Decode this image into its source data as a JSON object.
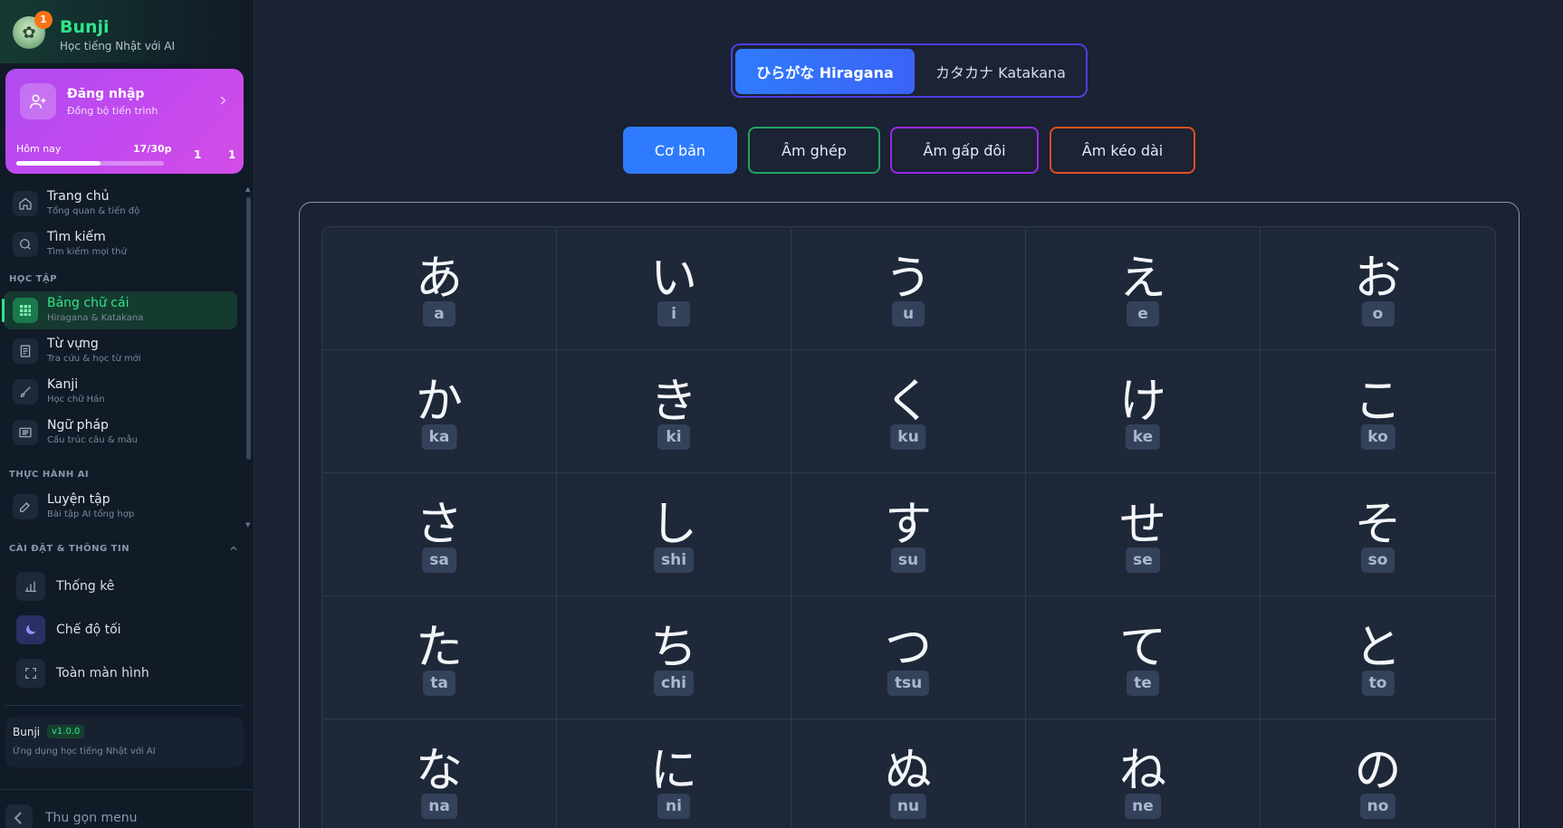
{
  "brand": {
    "name": "Bunji",
    "subtitle": "Học tiếng Nhật với AI",
    "notification_count": "1"
  },
  "login": {
    "title": "Đăng nhập",
    "subtitle": "Đồng bộ tiến trình",
    "today_label": "Hôm nay",
    "today_value": "17/30p",
    "progress_fraction": 0.57,
    "stat_a": "1",
    "stat_b": "1"
  },
  "nav": {
    "items_top": [
      {
        "label": "Trang chủ",
        "sub": "Tổng quan & tiến độ",
        "icon": "home-icon"
      },
      {
        "label": "Tìm kiếm",
        "sub": "Tìm kiếm mọi thứ",
        "icon": "search-icon"
      }
    ],
    "section_learn": "HỌC TẬP",
    "items_learn": [
      {
        "label": "Bảng chữ cái",
        "sub": "Hiragana & Katakana",
        "icon": "grid-icon",
        "active": true
      },
      {
        "label": "Từ vựng",
        "sub": "Tra cứu & học từ mới",
        "icon": "book-icon"
      },
      {
        "label": "Kanji",
        "sub": "Học chữ Hán",
        "icon": "brush-icon"
      },
      {
        "label": "Ngữ pháp",
        "sub": "Cấu trúc câu & mẫu",
        "icon": "list-icon"
      }
    ],
    "section_ai": "THỰC HÀNH AI",
    "items_ai": [
      {
        "label": "Luyện tập",
        "sub": "Bài tập AI tổng hợp",
        "icon": "edit-icon"
      }
    ]
  },
  "settings": {
    "header": "CÀI ĐẶT & THÔNG TIN",
    "items": [
      {
        "label": "Thống kê",
        "icon": "chart-icon"
      },
      {
        "label": "Chế độ tối",
        "icon": "moon-icon"
      },
      {
        "label": "Toàn màn hình",
        "icon": "fullscreen-icon"
      }
    ]
  },
  "app_info": {
    "name": "Bunji",
    "version": "v1.0.0",
    "description": "Ứng dụng học tiếng Nhật với AI"
  },
  "collapse_label": "Thu gọn menu",
  "script_tabs": [
    {
      "label": "ひらがな Hiragana",
      "active": true
    },
    {
      "label": "カタカナ Katakana",
      "active": false
    }
  ],
  "categories": [
    {
      "label": "Cơ bản",
      "active": true,
      "border": "#2f7bff"
    },
    {
      "label": "Âm ghép",
      "active": false,
      "border": "#1fa463"
    },
    {
      "label": "Âm gấp đôi",
      "active": false,
      "border": "#9c27e8"
    },
    {
      "label": "Âm kéo dài",
      "active": false,
      "border": "#e0501f"
    }
  ],
  "kana_grid": [
    {
      "kana": "あ",
      "romaji": "a"
    },
    {
      "kana": "い",
      "romaji": "i"
    },
    {
      "kana": "う",
      "romaji": "u"
    },
    {
      "kana": "え",
      "romaji": "e"
    },
    {
      "kana": "お",
      "romaji": "o"
    },
    {
      "kana": "か",
      "romaji": "ka"
    },
    {
      "kana": "き",
      "romaji": "ki"
    },
    {
      "kana": "く",
      "romaji": "ku"
    },
    {
      "kana": "け",
      "romaji": "ke"
    },
    {
      "kana": "こ",
      "romaji": "ko"
    },
    {
      "kana": "さ",
      "romaji": "sa"
    },
    {
      "kana": "し",
      "romaji": "shi"
    },
    {
      "kana": "す",
      "romaji": "su"
    },
    {
      "kana": "せ",
      "romaji": "se"
    },
    {
      "kana": "そ",
      "romaji": "so"
    },
    {
      "kana": "た",
      "romaji": "ta"
    },
    {
      "kana": "ち",
      "romaji": "chi"
    },
    {
      "kana": "つ",
      "romaji": "tsu"
    },
    {
      "kana": "て",
      "romaji": "te"
    },
    {
      "kana": "と",
      "romaji": "to"
    },
    {
      "kana": "な",
      "romaji": "na"
    },
    {
      "kana": "に",
      "romaji": "ni"
    },
    {
      "kana": "ぬ",
      "romaji": "nu"
    },
    {
      "kana": "ね",
      "romaji": "ne"
    },
    {
      "kana": "の",
      "romaji": "no"
    }
  ],
  "colors": {
    "accent_green": "#2ee58a",
    "accent_blue": "#2f7bff",
    "login_gradient_start": "#b04cf0",
    "login_gradient_end": "#d34de6"
  }
}
